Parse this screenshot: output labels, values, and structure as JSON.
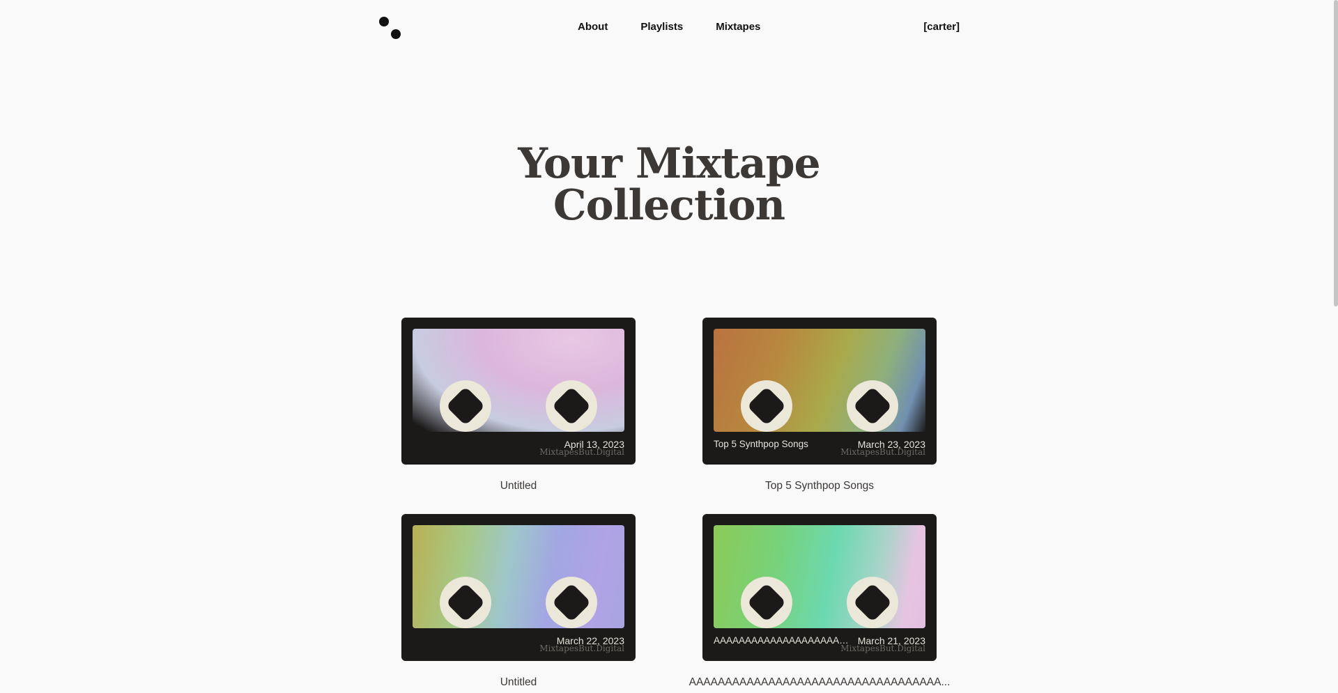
{
  "header": {
    "nav": [
      "About",
      "Playlists",
      "Mixtapes"
    ],
    "user": "[carter]"
  },
  "title": [
    "Your Mixtape",
    "Collection"
  ],
  "brand": "MixtapesBut.Digital",
  "mixtapes": [
    {
      "card_name": "",
      "date": "April 13, 2023",
      "caption": "Untitled",
      "gradient": "radial-gradient(ellipse at 75% 10%, #e8c7e4 0%, #dcb6dc 40%, #c7cce0 70%, #1c1a19 95%)"
    },
    {
      "card_name": "Top 5 Synthpop Songs",
      "date": "March 23, 2023",
      "caption": "Top 5 Synthpop Songs",
      "gradient": "linear-gradient(110deg, #b9723f 0%, #b8883f 30%, #a9a94a 55%, #8eb07c 75%, #7190b0 90%, #1c1a19 100%)"
    },
    {
      "card_name": "",
      "date": "March 22, 2023",
      "caption": "Untitled",
      "gradient": "linear-gradient(100deg, #b9b054 0%, #a6c988 25%, #9ec6ca 45%, #a2a6e3 65%, #b0a3e6 85%, #a9a4e0 100%)"
    },
    {
      "card_name": "AAAAAAAAAAAAAAAAAAAAAAAAAAAAAAAAAAA",
      "date": "March 21, 2023",
      "caption": "AAAAAAAAAAAAAAAAAAAAAAAAAAAAAAAAAAA...",
      "gradient": "linear-gradient(100deg, #8cca58 0%, #77d27a 30%, #6cd8b0 55%, #a6d4c8 75%, #e6c4e1 90%, #e2bfe0 100%)"
    }
  ]
}
